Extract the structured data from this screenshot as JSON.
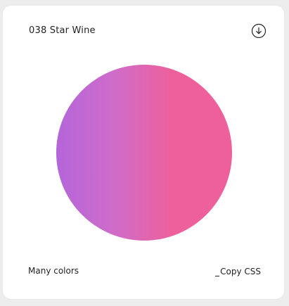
{
  "card": {
    "title": "038 Star Wine",
    "download_icon": "arrow-down-circle-icon",
    "gradient": {
      "direction": "to right",
      "stops": [
        {
          "color": "#b465da",
          "position": 0
        },
        {
          "color": "#cf6cc9",
          "position": 33
        },
        {
          "color": "#ee609c",
          "position": 66
        },
        {
          "color": "#ee609c",
          "position": 100
        }
      ]
    },
    "footer_label": "Many colors",
    "copy_label": "Copy CSS"
  },
  "colors": {
    "background": "#ededed",
    "card": "#ffffff",
    "text": "#222222"
  }
}
